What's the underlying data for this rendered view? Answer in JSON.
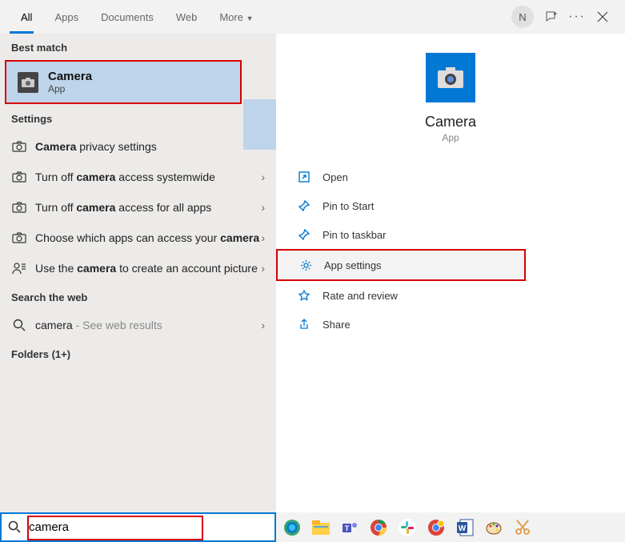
{
  "tabs": {
    "all": "All",
    "apps": "Apps",
    "documents": "Documents",
    "web": "Web",
    "more": "More"
  },
  "header": {
    "avatar_initial": "N"
  },
  "sections": {
    "best_match": "Best match",
    "settings": "Settings",
    "search_web": "Search the web",
    "folders": "Folders (1+)"
  },
  "best_match": {
    "title": "Camera",
    "subtitle": "App"
  },
  "settings_rows": [
    {
      "pre": "",
      "bold": "Camera",
      "post": " privacy settings"
    },
    {
      "pre": "Turn off ",
      "bold": "camera",
      "post": " access systemwide"
    },
    {
      "pre": "Turn off ",
      "bold": "camera",
      "post": " access for all apps"
    },
    {
      "pre": "Choose which apps can access your ",
      "bold": "camera",
      "post": ""
    },
    {
      "pre": "Use the ",
      "bold": "camera",
      "post": " to create an account picture"
    }
  ],
  "web_row": {
    "term": "camera",
    "suffix": " - See web results"
  },
  "detail": {
    "title": "Camera",
    "subtitle": "App"
  },
  "actions": {
    "open": "Open",
    "pin_start": "Pin to Start",
    "pin_taskbar": "Pin to taskbar",
    "app_settings": "App settings",
    "rate": "Rate and review",
    "share": "Share"
  },
  "search": {
    "value": "camera"
  },
  "colors": {
    "accent": "#0078d4",
    "highlight_border": "#d60000"
  }
}
